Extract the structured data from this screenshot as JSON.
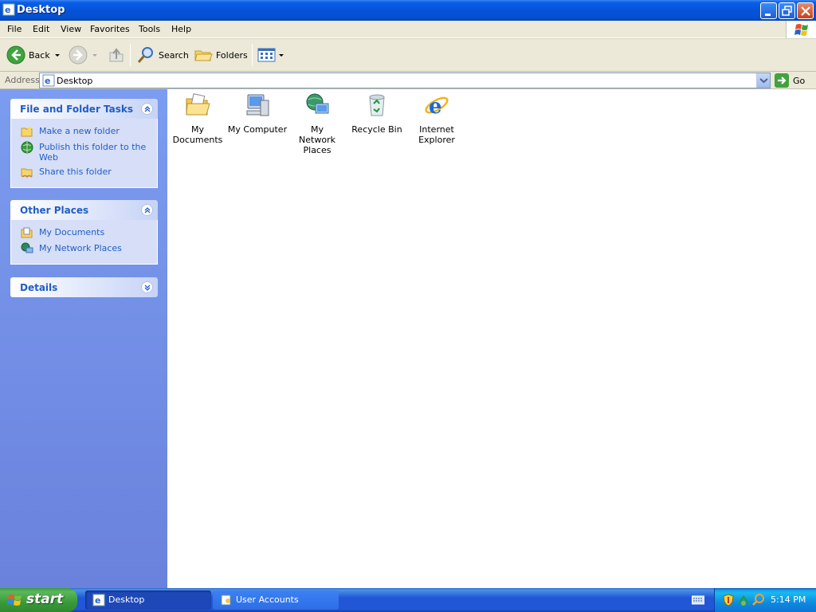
{
  "window": {
    "title": "Desktop"
  },
  "menu": [
    "File",
    "Edit",
    "View",
    "Favorites",
    "Tools",
    "Help"
  ],
  "toolbar": {
    "back_label": "Back",
    "search_label": "Search",
    "folders_label": "Folders"
  },
  "address": {
    "label": "Address",
    "value": "Desktop",
    "go_label": "Go"
  },
  "taskpane": {
    "file_tasks": {
      "title": "File and Folder Tasks",
      "items": [
        "Make a new folder",
        "Publish this folder to the Web",
        "Share this folder"
      ]
    },
    "other_places": {
      "title": "Other Places",
      "items": [
        "My Documents",
        "My Network Places"
      ]
    },
    "details": {
      "title": "Details"
    }
  },
  "desktop_items": [
    "My Documents",
    "My Computer",
    "My Network Places",
    "Recycle Bin",
    "Internet Explorer"
  ],
  "taskbar": {
    "start_label": "start",
    "buttons": [
      "Desktop",
      "User Accounts"
    ],
    "clock": "5:14 PM"
  },
  "colors": {
    "title_blue": "#0553d9",
    "task_link": "#215dc6",
    "pane_bg": "#7b9cf0",
    "start_green": "#3a9a3a"
  }
}
